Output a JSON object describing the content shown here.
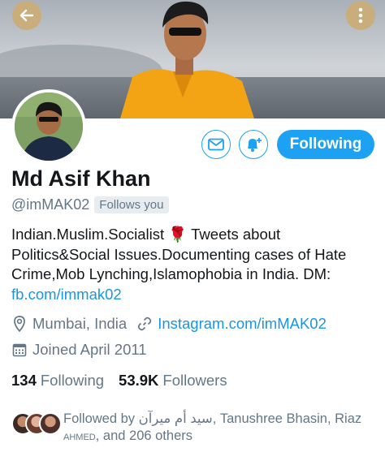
{
  "header": {
    "back_icon": "arrow-left-icon",
    "more_icon": "more-vertical-icon",
    "accent_color": "#c9ae7b"
  },
  "profile": {
    "name": "Md Asif Khan",
    "handle": "@imMAK02",
    "follows_you_badge": "Follows you",
    "bio_part1": "Indian.Muslim.Socialist ",
    "bio_emoji": "🌹",
    "bio_part2": " Tweets about Politics&Social Issues.Documenting cases of Hate Crime,Mob Lynching,Islamophobia in India. DM: ",
    "bio_link": "fb.com/immak02",
    "location": "Mumbai, India",
    "website": "Instagram.com/imMAK02",
    "joined": "Joined April 2011"
  },
  "actions": {
    "message_icon": "envelope-icon",
    "notify_icon": "bell-plus-icon",
    "follow_label": "Following",
    "brand_color": "#1da1f2"
  },
  "stats": {
    "following_count": "134",
    "following_label": "Following",
    "followers_count": "53.9K",
    "followers_label": "Followers"
  },
  "followed_by": {
    "prefix": "Followed by ",
    "name1": "سید أم میرآن",
    "name2": ", Tanushree Bhasin, Riaz",
    "name3": "AHMED",
    "suffix": ", and 206 others"
  }
}
